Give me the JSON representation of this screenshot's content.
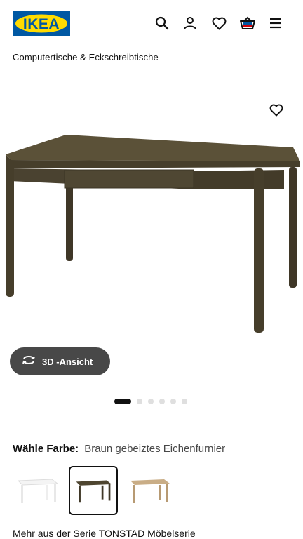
{
  "header": {
    "logo_text": "IKEA",
    "logo_colors": {
      "background": "#0058a3",
      "oval": "#ffdb00"
    },
    "icons": [
      "search-icon",
      "user-icon",
      "heart-icon",
      "basket-icon",
      "menu-icon"
    ]
  },
  "breadcrumb": "Computertische & Eckschreibtische",
  "gallery": {
    "favorite_icon": "heart-icon",
    "image": "brown-oak-desk",
    "view3d_label": "3D -Ansicht",
    "view3d_icon": "rotate-icon",
    "slides_total": 6,
    "slide_active": 1
  },
  "color": {
    "label": "Wähle Farbe:",
    "value": "Braun gebeiztes Eichenfurnier",
    "options": [
      {
        "name": "white-desk",
        "color": "#f2f2f2",
        "selected": false
      },
      {
        "name": "brown-desk",
        "color": "#4e4530",
        "selected": true
      },
      {
        "name": "oak-desk",
        "color": "#c9ad86",
        "selected": false
      }
    ]
  },
  "series_link": "Mehr aus der Serie TONSTAD Möbelserie",
  "colors": {
    "text": "#111111",
    "secondary": "#484848",
    "dot_inactive": "#dfdfdf",
    "desk": "#4e4530"
  }
}
